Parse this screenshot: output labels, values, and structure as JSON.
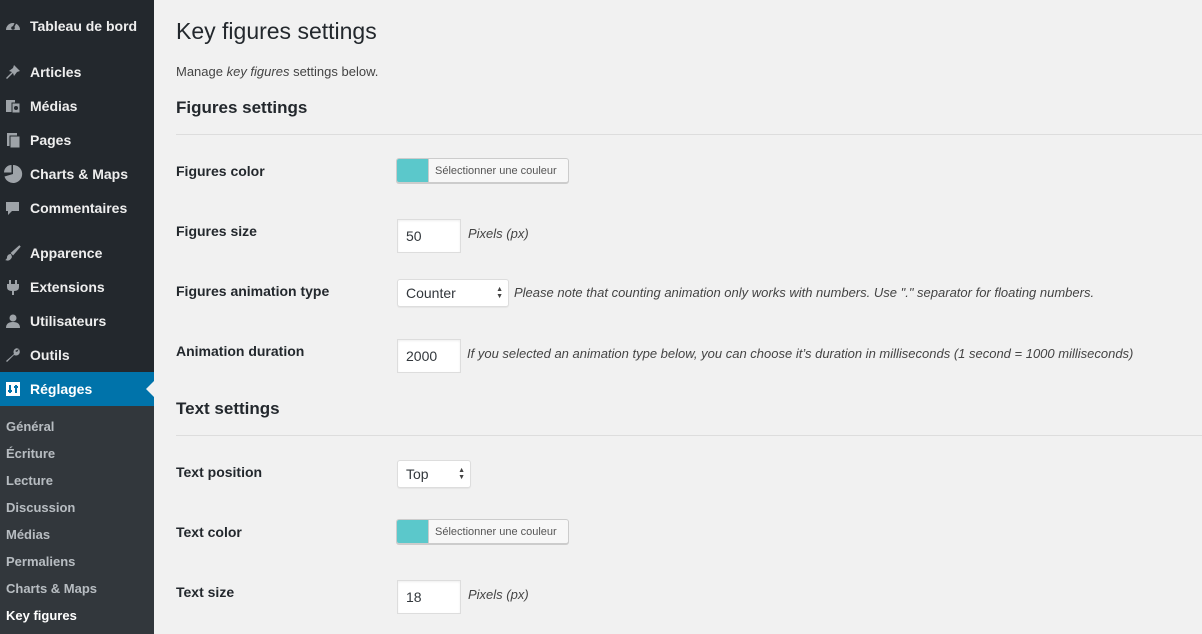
{
  "sidebar": {
    "items": [
      {
        "label": "Tableau de bord",
        "icon": "dashboard-icon"
      },
      {
        "label": "Articles",
        "icon": "pin-icon"
      },
      {
        "label": "Médias",
        "icon": "media-icon"
      },
      {
        "label": "Pages",
        "icon": "pages-icon"
      },
      {
        "label": "Charts & Maps",
        "icon": "pie-chart-icon"
      },
      {
        "label": "Commentaires",
        "icon": "comment-icon"
      },
      {
        "label": "Apparence",
        "icon": "paintbrush-icon"
      },
      {
        "label": "Extensions",
        "icon": "plugin-icon"
      },
      {
        "label": "Utilisateurs",
        "icon": "users-icon"
      },
      {
        "label": "Outils",
        "icon": "wrench-icon"
      },
      {
        "label": "Réglages",
        "icon": "settings-icon"
      }
    ],
    "submenu": [
      "Général",
      "Écriture",
      "Lecture",
      "Discussion",
      "Médias",
      "Permaliens",
      "Charts & Maps",
      "Key figures"
    ]
  },
  "page": {
    "title": "Key figures settings",
    "desc_pre": "Manage ",
    "desc_em": "key figures",
    "desc_post": " settings below."
  },
  "figures": {
    "heading": "Figures settings",
    "color_label": "Figures color",
    "color_button": "Sélectionner une couleur",
    "color_value": "#5bc8cb",
    "size_label": "Figures size",
    "size_value": "50",
    "size_hint": "Pixels (px)",
    "anim_label": "Figures animation type",
    "anim_value": "Counter",
    "anim_hint": "Please note that counting animation only works with numbers. Use \".\" separator for floating numbers.",
    "duration_label": "Animation duration",
    "duration_value": "2000",
    "duration_hint": "If you selected an animation type below, you can choose it’s duration in milliseconds (1 second = 1000 milliseconds)"
  },
  "text": {
    "heading": "Text settings",
    "position_label": "Text position",
    "position_value": "Top",
    "color_label": "Text color",
    "color_button": "Sélectionner une couleur",
    "color_value": "#5bc8cb",
    "size_label": "Text size",
    "size_value": "18",
    "size_hint": "Pixels (px)"
  }
}
